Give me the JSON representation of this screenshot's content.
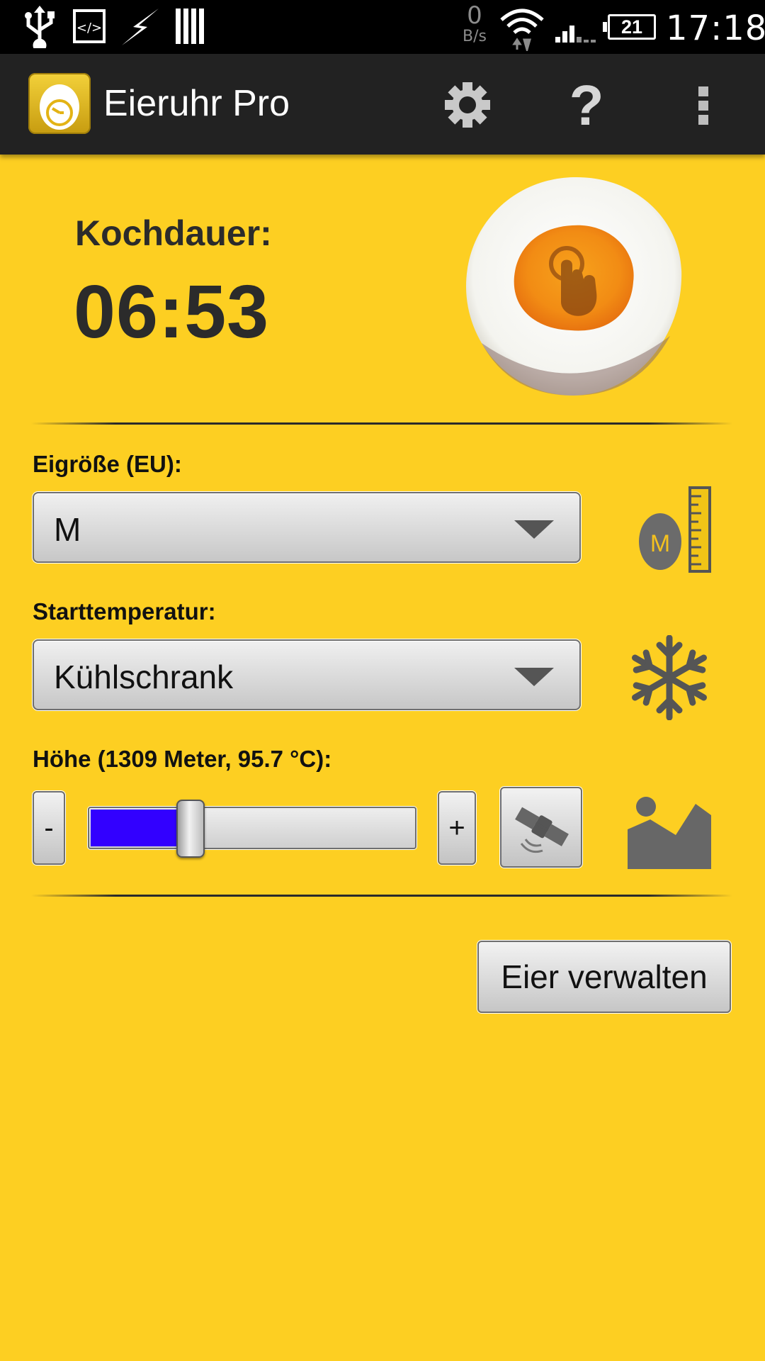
{
  "status_bar": {
    "net_speed_value": "0",
    "net_speed_unit": "B/s",
    "battery_level": "21",
    "time": "17:18",
    "icons": [
      "usb-icon",
      "code-icon",
      "lightning-icon",
      "bars-icon",
      "wifi-icon",
      "signal-icon",
      "battery-icon"
    ]
  },
  "action_bar": {
    "title": "Eieruhr Pro",
    "icons": [
      "app-egg-clock-icon",
      "gear-icon",
      "help-icon",
      "overflow-menu-icon"
    ]
  },
  "cooking": {
    "label": "Kochdauer:",
    "time": "06:53"
  },
  "egg_size": {
    "label": "Eigröße (EU):",
    "value": "M",
    "icon_letter": "M"
  },
  "start_temperature": {
    "label": "Starttemperatur:",
    "value": "Kühlschrank"
  },
  "altitude": {
    "label": "Höhe (1309 Meter, 95.7 °C):",
    "minus_label": "-",
    "plus_label": "+",
    "slider_fraction": 0.31
  },
  "manage_button_label": "Eier verwalten",
  "colors": {
    "background": "#fdcf22",
    "action_bar": "#222222",
    "slider_fill": "#3200ff",
    "text_dark": "#2b2b2b"
  }
}
